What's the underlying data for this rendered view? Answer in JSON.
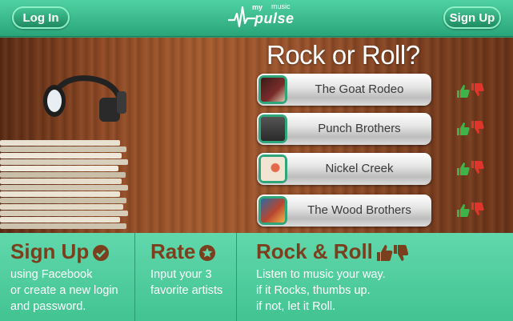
{
  "header": {
    "login_label": "Log In",
    "signup_label": "Sign Up",
    "logo": {
      "my": "my",
      "music": "music",
      "pulse": "pulse"
    }
  },
  "hero": {
    "title": "Rock or Roll?",
    "artists": [
      {
        "name": "The Goat Rodeo",
        "art_color": "#7a2c2a"
      },
      {
        "name": "Punch Brothers",
        "art_color": "#3b3b3b"
      },
      {
        "name": "Nickel Creek",
        "art_color": "#e9d8c4"
      },
      {
        "name": "The Wood Brothers",
        "art_color": "#b9452f"
      }
    ]
  },
  "steps": [
    {
      "title": "Sign Up",
      "lines": [
        "using Facebook",
        "or create a new login",
        "and password."
      ]
    },
    {
      "title": "Rate",
      "lines": [
        "Input your 3",
        "favorite artists"
      ]
    },
    {
      "title": "Rock & Roll",
      "lines": [
        "Listen to music your way.",
        "if it Rocks, thumbs up.",
        "if not, let it Roll."
      ]
    }
  ],
  "colors": {
    "brand_green": "#2fa67a",
    "heading_brown": "#7a3f1d",
    "thumb_up": "#3fb24a",
    "thumb_down": "#e0352b"
  }
}
